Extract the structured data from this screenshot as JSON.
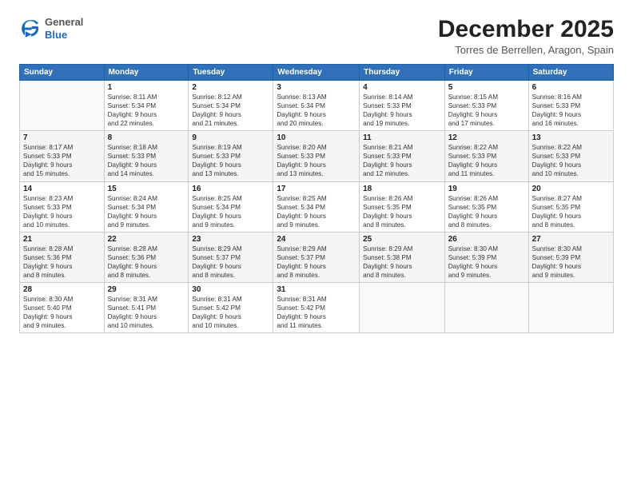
{
  "header": {
    "logo_general": "General",
    "logo_blue": "Blue",
    "month": "December 2025",
    "location": "Torres de Berrellen, Aragon, Spain"
  },
  "calendar": {
    "days_of_week": [
      "Sunday",
      "Monday",
      "Tuesday",
      "Wednesday",
      "Thursday",
      "Friday",
      "Saturday"
    ],
    "weeks": [
      [
        {
          "day": "",
          "info": ""
        },
        {
          "day": "1",
          "info": "Sunrise: 8:11 AM\nSunset: 5:34 PM\nDaylight: 9 hours\nand 22 minutes."
        },
        {
          "day": "2",
          "info": "Sunrise: 8:12 AM\nSunset: 5:34 PM\nDaylight: 9 hours\nand 21 minutes."
        },
        {
          "day": "3",
          "info": "Sunrise: 8:13 AM\nSunset: 5:34 PM\nDaylight: 9 hours\nand 20 minutes."
        },
        {
          "day": "4",
          "info": "Sunrise: 8:14 AM\nSunset: 5:33 PM\nDaylight: 9 hours\nand 19 minutes."
        },
        {
          "day": "5",
          "info": "Sunrise: 8:15 AM\nSunset: 5:33 PM\nDaylight: 9 hours\nand 17 minutes."
        },
        {
          "day": "6",
          "info": "Sunrise: 8:16 AM\nSunset: 5:33 PM\nDaylight: 9 hours\nand 16 minutes."
        }
      ],
      [
        {
          "day": "7",
          "info": "Sunrise: 8:17 AM\nSunset: 5:33 PM\nDaylight: 9 hours\nand 15 minutes."
        },
        {
          "day": "8",
          "info": "Sunrise: 8:18 AM\nSunset: 5:33 PM\nDaylight: 9 hours\nand 14 minutes."
        },
        {
          "day": "9",
          "info": "Sunrise: 8:19 AM\nSunset: 5:33 PM\nDaylight: 9 hours\nand 13 minutes."
        },
        {
          "day": "10",
          "info": "Sunrise: 8:20 AM\nSunset: 5:33 PM\nDaylight: 9 hours\nand 13 minutes."
        },
        {
          "day": "11",
          "info": "Sunrise: 8:21 AM\nSunset: 5:33 PM\nDaylight: 9 hours\nand 12 minutes."
        },
        {
          "day": "12",
          "info": "Sunrise: 8:22 AM\nSunset: 5:33 PM\nDaylight: 9 hours\nand 11 minutes."
        },
        {
          "day": "13",
          "info": "Sunrise: 8:22 AM\nSunset: 5:33 PM\nDaylight: 9 hours\nand 10 minutes."
        }
      ],
      [
        {
          "day": "14",
          "info": "Sunrise: 8:23 AM\nSunset: 5:33 PM\nDaylight: 9 hours\nand 10 minutes."
        },
        {
          "day": "15",
          "info": "Sunrise: 8:24 AM\nSunset: 5:34 PM\nDaylight: 9 hours\nand 9 minutes."
        },
        {
          "day": "16",
          "info": "Sunrise: 8:25 AM\nSunset: 5:34 PM\nDaylight: 9 hours\nand 9 minutes."
        },
        {
          "day": "17",
          "info": "Sunrise: 8:25 AM\nSunset: 5:34 PM\nDaylight: 9 hours\nand 9 minutes."
        },
        {
          "day": "18",
          "info": "Sunrise: 8:26 AM\nSunset: 5:35 PM\nDaylight: 9 hours\nand 8 minutes."
        },
        {
          "day": "19",
          "info": "Sunrise: 8:26 AM\nSunset: 5:35 PM\nDaylight: 9 hours\nand 8 minutes."
        },
        {
          "day": "20",
          "info": "Sunrise: 8:27 AM\nSunset: 5:35 PM\nDaylight: 9 hours\nand 8 minutes."
        }
      ],
      [
        {
          "day": "21",
          "info": "Sunrise: 8:28 AM\nSunset: 5:36 PM\nDaylight: 9 hours\nand 8 minutes."
        },
        {
          "day": "22",
          "info": "Sunrise: 8:28 AM\nSunset: 5:36 PM\nDaylight: 9 hours\nand 8 minutes."
        },
        {
          "day": "23",
          "info": "Sunrise: 8:29 AM\nSunset: 5:37 PM\nDaylight: 9 hours\nand 8 minutes."
        },
        {
          "day": "24",
          "info": "Sunrise: 8:29 AM\nSunset: 5:37 PM\nDaylight: 9 hours\nand 8 minutes."
        },
        {
          "day": "25",
          "info": "Sunrise: 8:29 AM\nSunset: 5:38 PM\nDaylight: 9 hours\nand 8 minutes."
        },
        {
          "day": "26",
          "info": "Sunrise: 8:30 AM\nSunset: 5:39 PM\nDaylight: 9 hours\nand 9 minutes."
        },
        {
          "day": "27",
          "info": "Sunrise: 8:30 AM\nSunset: 5:39 PM\nDaylight: 9 hours\nand 9 minutes."
        }
      ],
      [
        {
          "day": "28",
          "info": "Sunrise: 8:30 AM\nSunset: 5:40 PM\nDaylight: 9 hours\nand 9 minutes."
        },
        {
          "day": "29",
          "info": "Sunrise: 8:31 AM\nSunset: 5:41 PM\nDaylight: 9 hours\nand 10 minutes."
        },
        {
          "day": "30",
          "info": "Sunrise: 8:31 AM\nSunset: 5:42 PM\nDaylight: 9 hours\nand 10 minutes."
        },
        {
          "day": "31",
          "info": "Sunrise: 8:31 AM\nSunset: 5:42 PM\nDaylight: 9 hours\nand 11 minutes."
        },
        {
          "day": "",
          "info": ""
        },
        {
          "day": "",
          "info": ""
        },
        {
          "day": "",
          "info": ""
        }
      ]
    ]
  }
}
